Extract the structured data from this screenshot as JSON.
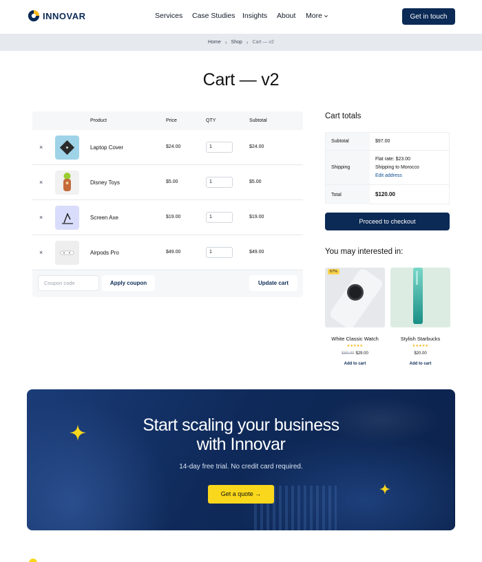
{
  "header": {
    "logo_text": "INNOVAR",
    "nav": [
      "Services",
      "Case Studies",
      "Insights",
      "About",
      "More"
    ],
    "cta": "Get in touch"
  },
  "breadcrumb": {
    "home": "Home",
    "shop": "Shop",
    "current": "Cart — v2"
  },
  "page_title": "Cart — v2",
  "cart": {
    "headers": {
      "product": "Product",
      "price": "Price",
      "qty": "QTY",
      "subtotal": "Subtotal"
    },
    "items": [
      {
        "name": "Laptop Cover",
        "price": "$24.00",
        "qty": "1",
        "subtotal": "$24.00"
      },
      {
        "name": "Disney Toys",
        "price": "$5.00",
        "qty": "1",
        "subtotal": "$5.00"
      },
      {
        "name": "Screen Axe",
        "price": "$19.00",
        "qty": "1",
        "subtotal": "$19.00"
      },
      {
        "name": "Airpods Pro",
        "price": "$49.00",
        "qty": "1",
        "subtotal": "$49.00"
      }
    ],
    "remove_symbol": "×",
    "coupon_placeholder": "Coupon code",
    "apply_coupon": "Apply coupon",
    "update_cart": "Update cart"
  },
  "totals": {
    "title": "Cart totals",
    "subtotal_label": "Subtotal",
    "subtotal_value": "$97.00",
    "shipping_label": "Shipping",
    "shipping_rate": "Flat rate: $23.00",
    "shipping_to": "Shipping to Morocco",
    "edit_address": "Edit address",
    "total_label": "Total",
    "total_value": "$120.00",
    "checkout": "Proceed to checkout"
  },
  "interest": {
    "title": "You may interested in:",
    "products": [
      {
        "badge": "67%",
        "name": "White Classic Watch",
        "stars": "★★★★★",
        "old_price": "$89.00",
        "price": "$29.00",
        "add": "Add to cart"
      },
      {
        "name": "Stylish Starbucks",
        "stars": "★★★★★",
        "price": "$20.00",
        "add": "Add to cart"
      }
    ]
  },
  "banner": {
    "heading_line1": "Start scaling your business",
    "heading_line2": "with Innovar",
    "subtitle": "14-day free trial. No credit card required.",
    "button": "Get a quote"
  },
  "colors": {
    "brand_navy": "#0b2a55",
    "accent_yellow": "#f9d71c"
  }
}
